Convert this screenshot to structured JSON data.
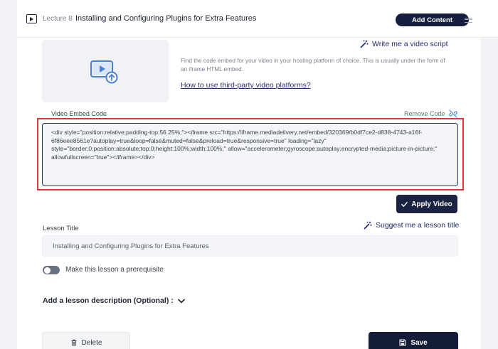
{
  "lecture": {
    "number_label": "Lecture 8",
    "title": "Installing and Configuring Plugins for Extra Features",
    "add_content_label": "Add Content"
  },
  "video": {
    "write_script_label": "Write me a video script",
    "help_text": "Find the code embed for your video in your hosting platform of choice. This is usually under the form of an iframe HTML embed.",
    "howto_link": "How to use third-party video platforms?",
    "embed_label": "Video Embed Code",
    "remove_code_label": "Remove Code",
    "embed_code": "<div style=\"position:relative;padding-top:56.25%;\"><iframe src=\"https://iframe.mediadelivery.net/embed/320369/b0df7ce2-d838-4743-a16f-6f86eee8561e?autoplay=true&loop=false&muted=false&preload=true&responsive=true\" loading=\"lazy\" style=\"border:0;position:absolute;top:0;height:100%;width:100%;\" allow=\"accelerometer;gyroscope;autoplay;encrypted-media;picture-in-picture;\" allowfullscreen=\"true\"></iframe></div>",
    "apply_label": "Apply Video"
  },
  "lesson": {
    "title_label": "Lesson Title",
    "suggest_label": "Suggest me a lesson title",
    "title_value": "Installing and Configuring Plugins for Extra Features",
    "prerequisite_label": "Make this lesson a prerequisite",
    "prerequisite_on": false,
    "description_toggle": "Add a lesson description (Optional) :"
  },
  "actions": {
    "delete_label": "Delete",
    "save_label": "Save"
  },
  "colors": {
    "primary_navy": "#152040",
    "highlight_red": "#e23434",
    "link_blue": "#1c2a6b",
    "icon_blue": "#4a7fd0"
  }
}
